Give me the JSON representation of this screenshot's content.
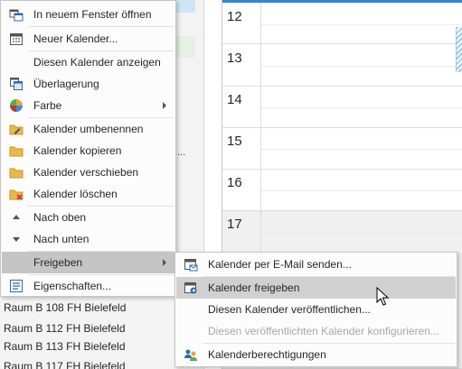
{
  "nav_pane": {
    "ellipsis": "...",
    "rooms": [
      "Raum B 108 FH Bielefeld",
      "Raum B 112 FH Bielefeld",
      "Raum B 113 FH Bielefeld",
      "Raum B 117 FH Bielefeld"
    ]
  },
  "calendar": {
    "hours": [
      "12",
      "13",
      "14",
      "15",
      "16",
      "17"
    ],
    "accent_color": "#2b88d8"
  },
  "context_menu": {
    "items": [
      {
        "label": "In neuem Fenster öffnen",
        "icon": "open-new-window-icon"
      },
      {
        "label": "Neuer Kalender...",
        "icon": "new-calendar-icon"
      },
      {
        "label": "Diesen Kalender anzeigen",
        "icon": ""
      },
      {
        "label": "Überlagerung",
        "icon": "overlay-icon"
      },
      {
        "label": "Farbe",
        "icon": "color-palette-icon",
        "has_submenu": true
      },
      {
        "label": "Kalender umbenennen",
        "icon": "folder-rename-icon"
      },
      {
        "label": "Kalender kopieren",
        "icon": "folder-copy-icon"
      },
      {
        "label": "Kalender verschieben",
        "icon": "folder-move-icon"
      },
      {
        "label": "Kalender löschen",
        "icon": "folder-delete-icon"
      },
      {
        "label": "Nach oben",
        "icon": "move-up-icon"
      },
      {
        "label": "Nach unten",
        "icon": "move-down-icon"
      },
      {
        "label": "Freigeben",
        "icon": "",
        "has_submenu": true,
        "highlighted": true
      },
      {
        "label": "Eigenschaften...",
        "icon": "properties-icon"
      }
    ]
  },
  "share_submenu": {
    "items": [
      {
        "label": "Kalender per E-Mail senden...",
        "icon": "email-calendar-icon",
        "enabled": true
      },
      {
        "label": "Kalender freigeben",
        "icon": "share-calendar-icon",
        "enabled": true,
        "highlighted": true
      },
      {
        "label": "Diesen Kalender veröffentlichen...",
        "icon": "",
        "enabled": true
      },
      {
        "label": "Diesen veröffentlichten Kalender konfigurieren...",
        "icon": "",
        "enabled": false
      },
      {
        "label": "Kalenderberechtigungen",
        "icon": "calendar-permissions-icon",
        "enabled": true
      }
    ]
  }
}
